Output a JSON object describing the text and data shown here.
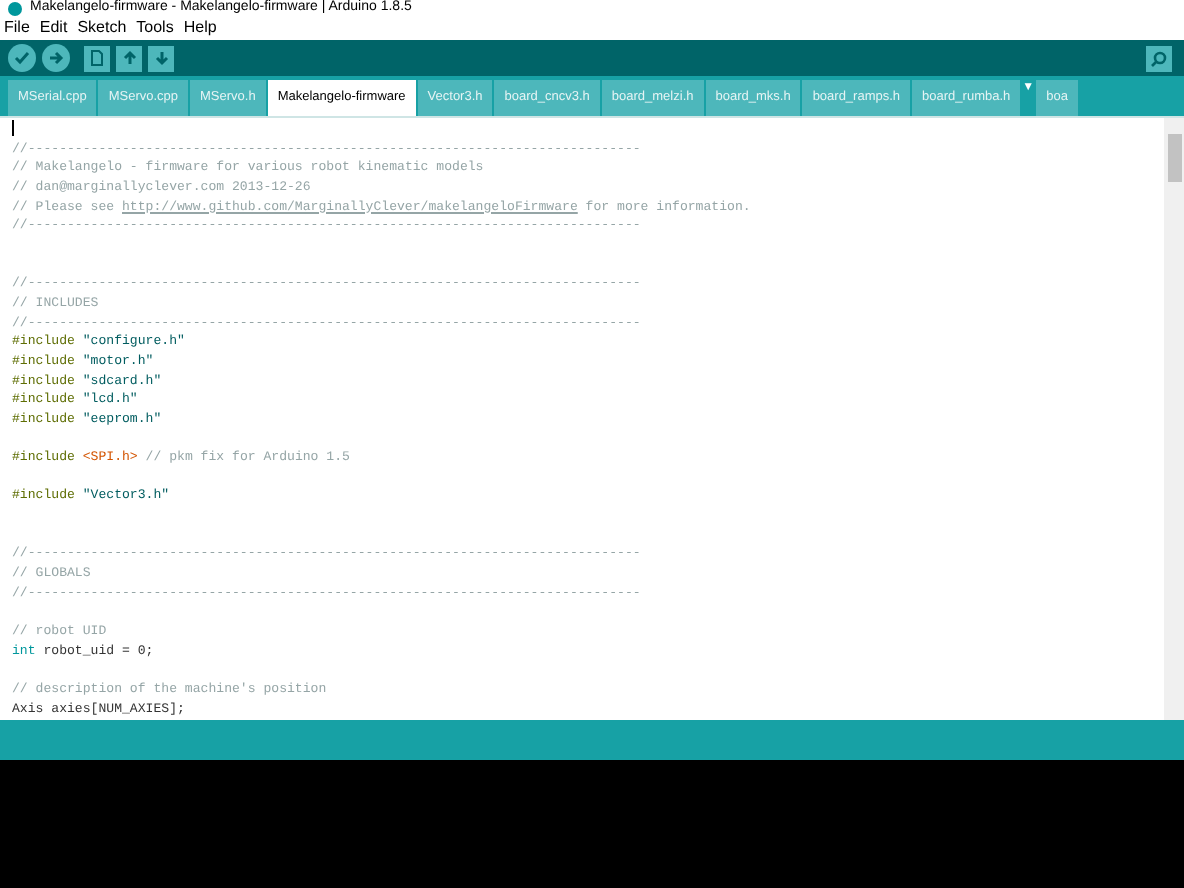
{
  "window": {
    "title": "Makelangelo-firmware - Makelangelo-firmware | Arduino 1.8.5"
  },
  "menu": [
    "File",
    "Edit",
    "Sketch",
    "Tools",
    "Help"
  ],
  "tabs": [
    {
      "label": "MSerial.cpp",
      "selected": false
    },
    {
      "label": "MServo.cpp",
      "selected": false
    },
    {
      "label": "MServo.h",
      "selected": false
    },
    {
      "label": "Makelangelo-firmware",
      "selected": true
    },
    {
      "label": "Vector3.h",
      "selected": false
    },
    {
      "label": "board_cncv3.h",
      "selected": false
    },
    {
      "label": "board_melzi.h",
      "selected": false
    },
    {
      "label": "board_mks.h",
      "selected": false
    },
    {
      "label": "board_ramps.h",
      "selected": false
    },
    {
      "label": "board_rumba.h",
      "selected": false
    },
    {
      "label": "boa",
      "selected": false
    }
  ],
  "tab_menu": "▼",
  "code_lines": [
    {
      "kind": "blank"
    },
    {
      "kind": "code",
      "tokens": [
        {
          "kind": "comment",
          "text": "//------------------------------------------------------------------------------"
        }
      ]
    },
    {
      "kind": "code",
      "tokens": [
        {
          "kind": "comment",
          "text": "// Makelangelo - firmware for various robot kinematic models"
        }
      ]
    },
    {
      "kind": "code",
      "tokens": [
        {
          "kind": "comment",
          "text": "// dan@marginallyclever.com 2013-12-26"
        }
      ]
    },
    {
      "kind": "code",
      "tokens": [
        {
          "kind": "comment",
          "text": "// Please see"
        },
        {
          "kind": "link",
          "text": "http://www.github.com/MarginallyClever/makelangeloFirmware"
        },
        {
          "kind": "comment",
          "text": "for more information."
        }
      ]
    },
    {
      "kind": "code",
      "tokens": [
        {
          "kind": "comment",
          "text": "//------------------------------------------------------------------------------"
        }
      ]
    },
    {
      "kind": "blank"
    },
    {
      "kind": "blank"
    },
    {
      "kind": "code",
      "tokens": [
        {
          "kind": "comment",
          "text": "//------------------------------------------------------------------------------"
        }
      ]
    },
    {
      "kind": "code",
      "tokens": [
        {
          "kind": "comment",
          "text": "// INCLUDES"
        }
      ]
    },
    {
      "kind": "code",
      "tokens": [
        {
          "kind": "comment",
          "text": "//------------------------------------------------------------------------------"
        }
      ]
    },
    {
      "kind": "code",
      "tokens": [
        {
          "kind": "directive",
          "text": "#include"
        },
        {
          "kind": "string",
          "text": "\"configure.h\""
        }
      ]
    },
    {
      "kind": "code",
      "tokens": [
        {
          "kind": "directive",
          "text": "#include"
        },
        {
          "kind": "string",
          "text": "\"motor.h\""
        }
      ]
    },
    {
      "kind": "code",
      "tokens": [
        {
          "kind": "directive",
          "text": "#include"
        },
        {
          "kind": "string",
          "text": "\"sdcard.h\""
        }
      ]
    },
    {
      "kind": "code",
      "tokens": [
        {
          "kind": "directive",
          "text": "#include"
        },
        {
          "kind": "string",
          "text": "\"lcd.h\""
        }
      ]
    },
    {
      "kind": "code",
      "tokens": [
        {
          "kind": "directive",
          "text": "#include"
        },
        {
          "kind": "string",
          "text": "\"eeprom.h\""
        }
      ]
    },
    {
      "kind": "blank"
    },
    {
      "kind": "code",
      "tokens": [
        {
          "kind": "directive",
          "text": "#include"
        },
        {
          "kind": "library",
          "text": "<SPI.h>"
        },
        {
          "kind": "comment",
          "text": "// pkm fix for Arduino 1.5"
        }
      ]
    },
    {
      "kind": "blank"
    },
    {
      "kind": "code",
      "tokens": [
        {
          "kind": "directive",
          "text": "#include"
        },
        {
          "kind": "string",
          "text": "\"Vector3.h\""
        }
      ]
    },
    {
      "kind": "blank"
    },
    {
      "kind": "blank"
    },
    {
      "kind": "code",
      "tokens": [
        {
          "kind": "comment",
          "text": "//------------------------------------------------------------------------------"
        }
      ]
    },
    {
      "kind": "code",
      "tokens": [
        {
          "kind": "comment",
          "text": "// GLOBALS"
        }
      ]
    },
    {
      "kind": "code",
      "tokens": [
        {
          "kind": "comment",
          "text": "//------------------------------------------------------------------------------"
        }
      ]
    },
    {
      "kind": "blank"
    },
    {
      "kind": "code",
      "tokens": [
        {
          "kind": "comment",
          "text": "// robot UID"
        }
      ]
    },
    {
      "kind": "code",
      "tokens": [
        {
          "kind": "type",
          "text": "int"
        },
        {
          "kind": "plain",
          "text": "robot_uid = 0;"
        }
      ]
    },
    {
      "kind": "blank"
    },
    {
      "kind": "code",
      "tokens": [
        {
          "kind": "comment",
          "text": "// description of the machine's position"
        }
      ]
    },
    {
      "kind": "code",
      "tokens": [
        {
          "kind": "plain",
          "text": "Axis axies[NUM_AXIES];"
        }
      ]
    }
  ]
}
